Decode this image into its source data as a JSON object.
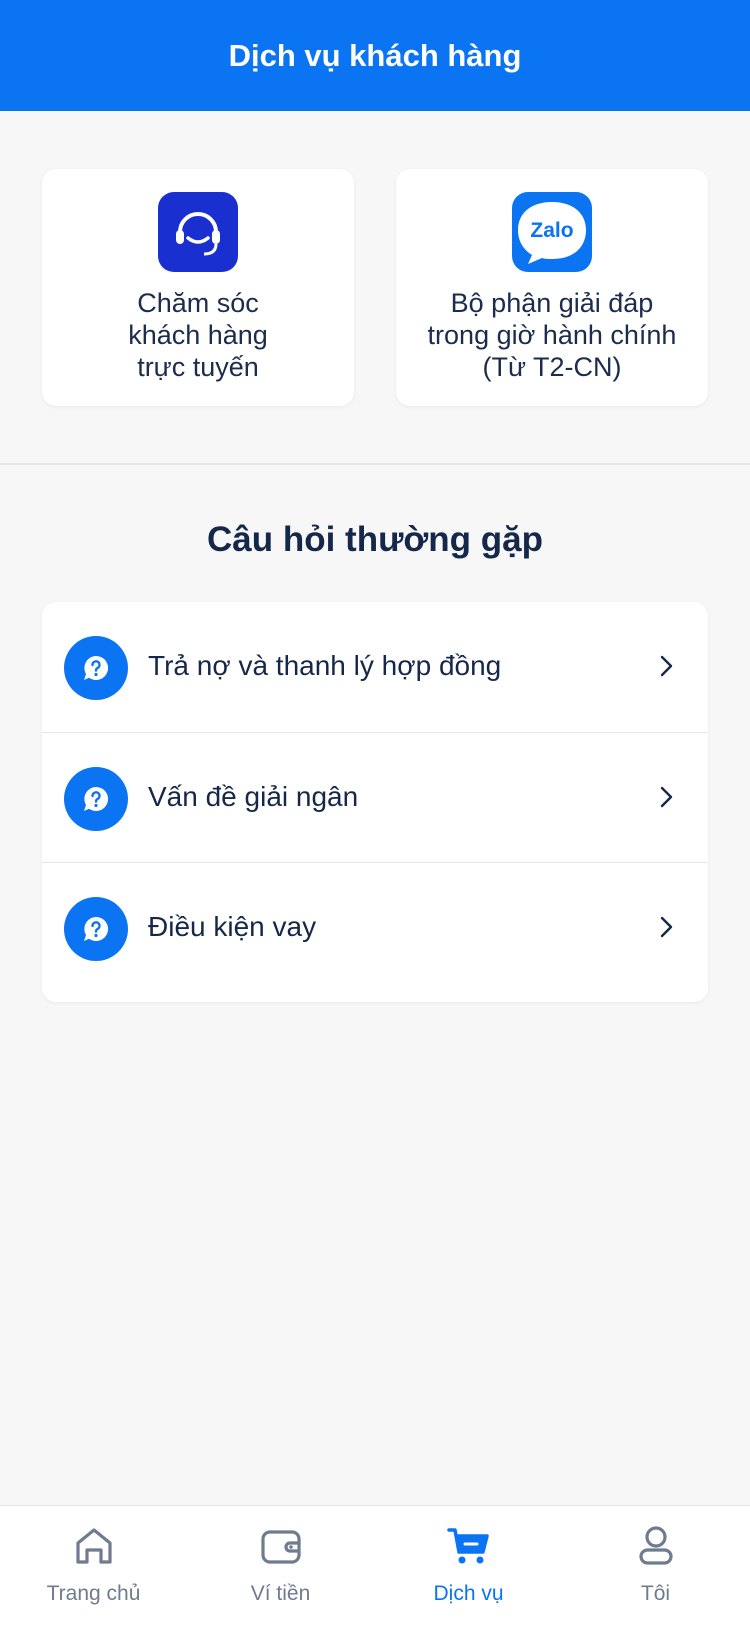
{
  "header": {
    "title": "Dịch vụ khách hàng"
  },
  "contacts": [
    {
      "label": "Chăm sóc\nkhách hàng\ntrực tuyến",
      "icon": "headset-icon"
    },
    {
      "label": "Bộ phận giải đáp\ntrong giờ hành chính\n(Từ T2-CN)",
      "icon": "zalo-icon",
      "logo_text": "Zalo"
    }
  ],
  "faq": {
    "title": "Câu hỏi thường gặp",
    "items": [
      {
        "label": "Trả nợ và thanh lý hợp đồng",
        "icon": "question-chat-icon"
      },
      {
        "label": "Vấn đề giải ngân",
        "icon": "question-chat-icon"
      },
      {
        "label": "Điều kiện vay",
        "icon": "question-chat-icon"
      }
    ]
  },
  "tabbar": {
    "active": "Dịch vụ",
    "items": [
      {
        "label": "Trang chủ",
        "icon": "home-icon"
      },
      {
        "label": "Ví tiền",
        "icon": "wallet-icon"
      },
      {
        "label": "Dịch vụ",
        "icon": "cart-icon"
      },
      {
        "label": "Tôi",
        "icon": "user-icon"
      }
    ]
  },
  "colors": {
    "primary": "#0a74f2",
    "headset_bg": "#1a2fd0",
    "text": "#16284a",
    "inactive": "#6f7b8f"
  }
}
